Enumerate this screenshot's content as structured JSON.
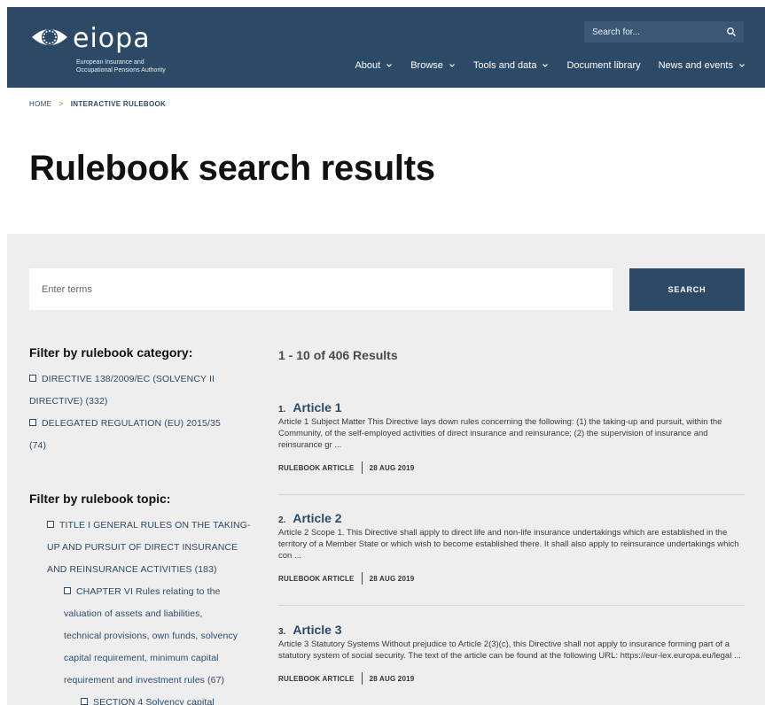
{
  "header": {
    "logo_word": "eiopa",
    "logo_subtitle_line1": "European Insurance and",
    "logo_subtitle_line2": "Occupational Pensions Authority",
    "search_placeholder": "Search for...",
    "nav": [
      {
        "label": "About",
        "has_dropdown": true
      },
      {
        "label": "Browse",
        "has_dropdown": true
      },
      {
        "label": "Tools and data",
        "has_dropdown": true
      },
      {
        "label": "Document library",
        "has_dropdown": false
      },
      {
        "label": "News and events",
        "has_dropdown": true
      }
    ]
  },
  "breadcrumb": {
    "home": "HOME",
    "separator": ">",
    "current": "INTERACTIVE RULEBOOK"
  },
  "page_title": "Rulebook search results",
  "search": {
    "placeholder": "Enter terms",
    "button_label": "SEARCH"
  },
  "filters": {
    "category_heading": "Filter by rulebook category:",
    "categories": [
      {
        "line1": "DIRECTIVE 138/2009/EC (SOLVENCY II",
        "line2": "DIRECTIVE) (332)"
      },
      {
        "line1": "DELEGATED REGULATION (EU) 2015/35",
        "line2": "(74)"
      }
    ],
    "topic_heading": "Filter by rulebook topic:",
    "topics": [
      {
        "lines": [
          "TITLE I GENERAL RULES ON THE TAKING-",
          "UP AND PURSUIT OF DIRECT INSURANCE",
          "AND REINSURANCE ACTIVITIES (183)"
        ]
      },
      {
        "lines": [
          "CHAPTER VI Rules relating to the",
          "valuation of assets and liabilities,",
          "technical provisions, own funds, solvency",
          "capital requirement, minimum capital",
          "requirement and investment rules (67)"
        ]
      },
      {
        "lines": [
          "SECTION 4 Solvency capital"
        ]
      }
    ]
  },
  "results": {
    "count_label": "1 - 10 of 406 Results",
    "items": [
      {
        "num": "1.",
        "title": "Article 1",
        "snippet": "Article 1 Subject Matter This Directive lays down rules concerning the following: (1) the taking-up and pursuit, within the Community, of the self-employed activities of direct insurance and reinsurance; (2) the supervision of insurance and reinsurance gr ...",
        "type": "RULEBOOK ARTICLE",
        "date": "28 AUG 2019"
      },
      {
        "num": "2.",
        "title": "Article 2",
        "snippet": "Article 2 Scope 1.  This Directive shall apply to direct life and non-life insurance undertakings which are established in the territory of a Member State or which wish to become established there. It shall also apply to reinsurance undertakings which con ...",
        "type": "RULEBOOK ARTICLE",
        "date": "28 AUG 2019"
      },
      {
        "num": "3.",
        "title": "Article 3",
        "snippet": "Article 3 Statutory Systems Without prejudice to Article 2(3)(c), this Directive shall not apply to insurance forming part of a statutory system of social security. The text of the article can be found at the following URL: https://eur-lex.europa.eu/legal ...",
        "type": "RULEBOOK ARTICLE",
        "date": "28 AUG 2019"
      }
    ]
  },
  "colors": {
    "brand": "#2c4a66",
    "accent": "#e07a2c",
    "panel": "#eeeeee"
  }
}
